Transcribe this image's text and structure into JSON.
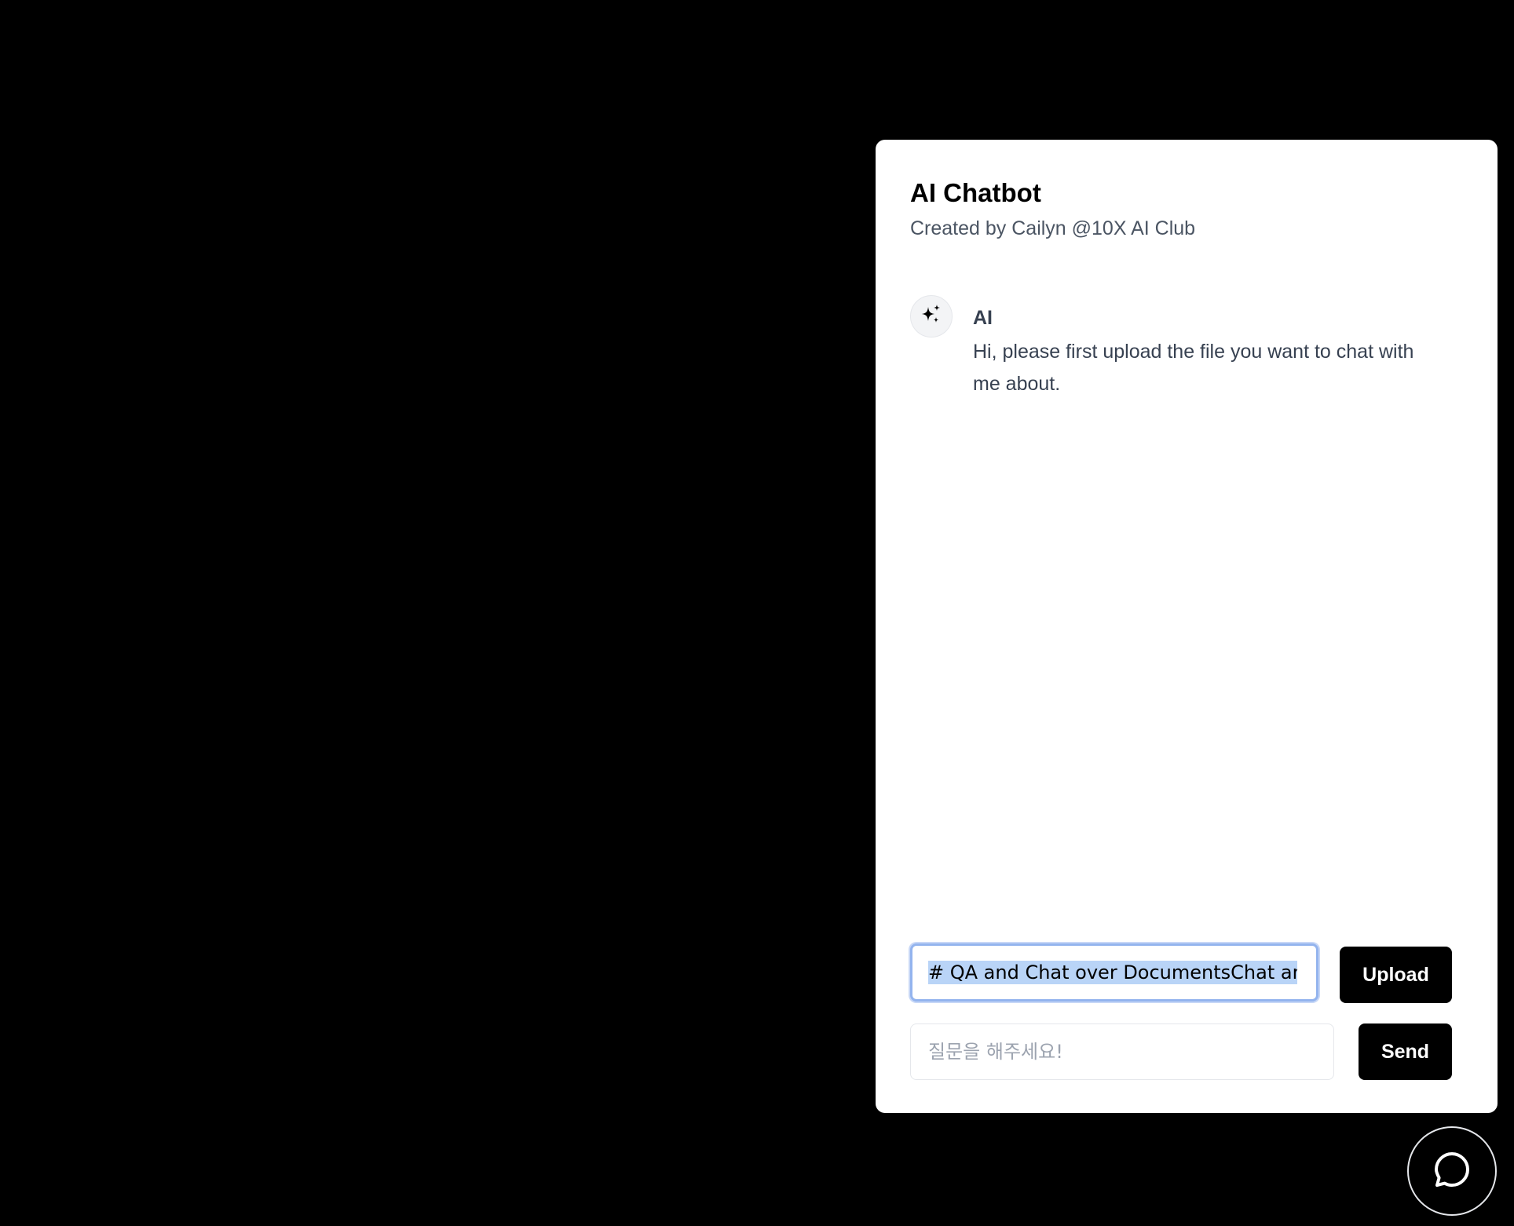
{
  "chatbot": {
    "title": "AI Chatbot",
    "subtitle": "Created by Cailyn @10X AI Club"
  },
  "messages": [
    {
      "sender": "AI",
      "avatar_icon": "sparkles-icon",
      "text": "Hi, please first upload the file you want to chat with me about."
    }
  ],
  "upload": {
    "value": "# QA and Chat over DocumentsChat and",
    "button_label": "Upload"
  },
  "question": {
    "placeholder": "질문을 해주세요!",
    "value": "",
    "button_label": "Send"
  },
  "launcher": {
    "icon": "chat-bubble-icon"
  },
  "colors": {
    "background": "#000000",
    "panel": "#ffffff",
    "button": "#000000",
    "button_text": "#ffffff",
    "selection": "#b9d4f7",
    "focus_ring": "#93b4ee"
  }
}
